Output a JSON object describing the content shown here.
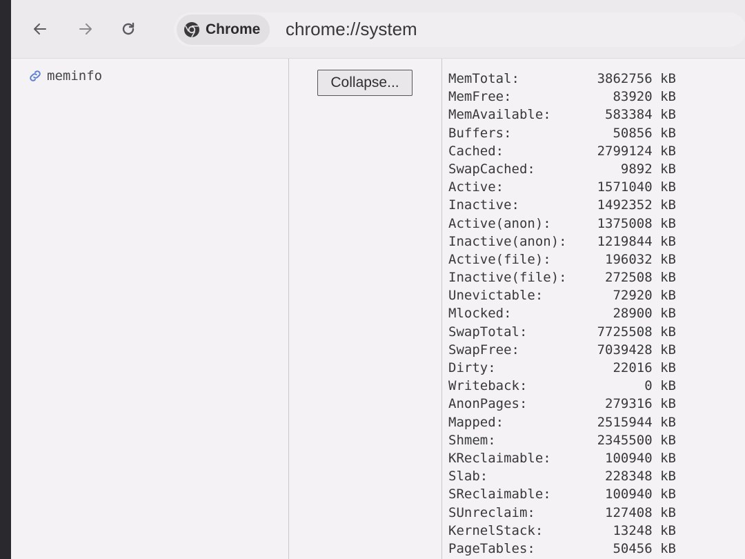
{
  "toolbar": {
    "chip_label": "Chrome",
    "url": "chrome://system"
  },
  "entry": {
    "key": "meminfo",
    "collapse_label": "Collapse..."
  },
  "meminfo": [
    {
      "name": "MemTotal:",
      "value": "3862756 kB"
    },
    {
      "name": "MemFree:",
      "value": "83920 kB"
    },
    {
      "name": "MemAvailable:",
      "value": "583384 kB"
    },
    {
      "name": "Buffers:",
      "value": "50856 kB"
    },
    {
      "name": "Cached:",
      "value": "2799124 kB"
    },
    {
      "name": "SwapCached:",
      "value": "9892 kB"
    },
    {
      "name": "Active:",
      "value": "1571040 kB"
    },
    {
      "name": "Inactive:",
      "value": "1492352 kB"
    },
    {
      "name": "Active(anon):",
      "value": "1375008 kB"
    },
    {
      "name": "Inactive(anon):",
      "value": "1219844 kB"
    },
    {
      "name": "Active(file):",
      "value": "196032 kB"
    },
    {
      "name": "Inactive(file):",
      "value": "272508 kB"
    },
    {
      "name": "Unevictable:",
      "value": "72920 kB"
    },
    {
      "name": "Mlocked:",
      "value": "28900 kB"
    },
    {
      "name": "SwapTotal:",
      "value": "7725508 kB"
    },
    {
      "name": "SwapFree:",
      "value": "7039428 kB"
    },
    {
      "name": "Dirty:",
      "value": "22016 kB"
    },
    {
      "name": "Writeback:",
      "value": "0 kB"
    },
    {
      "name": "AnonPages:",
      "value": "279316 kB"
    },
    {
      "name": "Mapped:",
      "value": "2515944 kB"
    },
    {
      "name": "Shmem:",
      "value": "2345500 kB"
    },
    {
      "name": "KReclaimable:",
      "value": "100940 kB"
    },
    {
      "name": "Slab:",
      "value": "228348 kB"
    },
    {
      "name": "SReclaimable:",
      "value": "100940 kB"
    },
    {
      "name": "SUnreclaim:",
      "value": "127408 kB"
    },
    {
      "name": "KernelStack:",
      "value": "13248 kB"
    },
    {
      "name": "PageTables:",
      "value": "50456 kB"
    }
  ]
}
